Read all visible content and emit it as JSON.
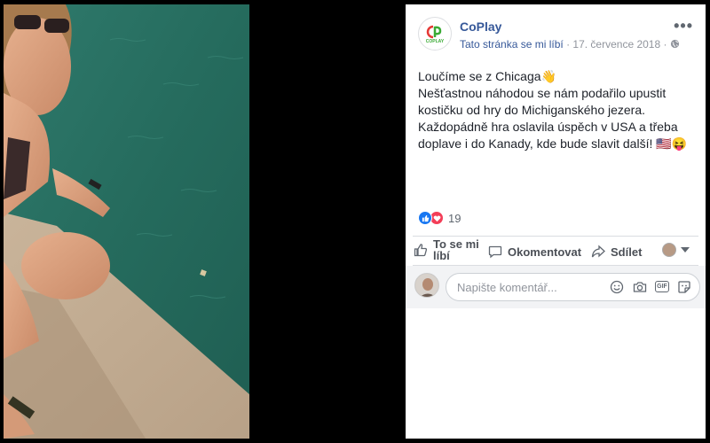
{
  "post": {
    "page_name": "CoPlay",
    "logo_text": "COPLAY",
    "like_page_link": "Tato stránka se mi líbí",
    "separator": "·",
    "date": "17. července 2018",
    "privacy_icon": "globe-icon",
    "more_icon": "more-options-icon",
    "more_label": "•••",
    "lines": [
      "Loučíme se z Chicaga👋",
      "Nešťastnou náhodou se nám podařilo upustit",
      "kostičku od hry do Michiganského jezera.",
      "Každopádně hra oslavila úspěch v USA a třeba",
      "doplave i do Kanady, kde bude slavit další! 🇺🇸😝"
    ]
  },
  "reactions": {
    "count": "19",
    "types": [
      "like",
      "love"
    ]
  },
  "actions": {
    "like_line1": "To se mi",
    "like_line2": "líbí",
    "comment": "Okomentovat",
    "share": "Sdílet"
  },
  "comment": {
    "placeholder": "Napište komentář..."
  },
  "colors": {
    "brand_link": "#365899",
    "like_blue": "#1877f2",
    "love_red": "#f33e58",
    "logo_green": "#3aaa35",
    "logo_red": "#e53935"
  }
}
